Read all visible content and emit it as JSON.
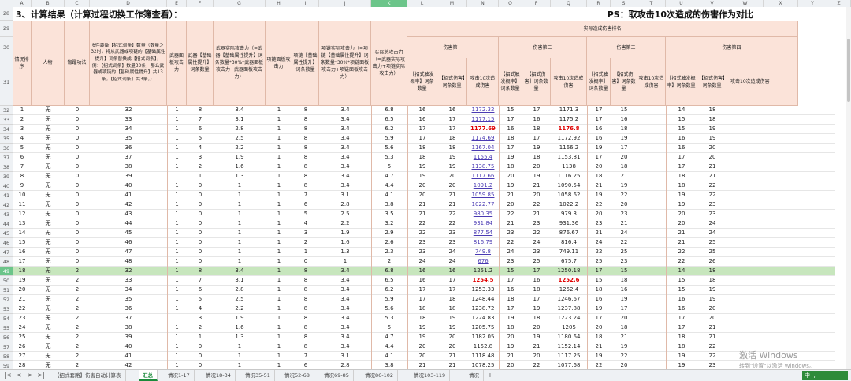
{
  "columns": [
    "A",
    "B",
    "C",
    "D",
    "E",
    "F",
    "G",
    "H",
    "I",
    "J",
    "K",
    "L",
    "M",
    "N",
    "O",
    "P",
    "Q",
    "R",
    "S",
    "T",
    "U",
    "V",
    "W",
    "X",
    "Y",
    "Z"
  ],
  "selected_column": "K",
  "title": {
    "left": "3、计算结果（计算过程切换工作簿查看）：",
    "right": "PS：取攻击10次造成的伤害作为对比"
  },
  "row_numbers": {
    "r28": "28",
    "r29": "29",
    "r30": "30",
    "r31": "31"
  },
  "headers": {
    "a": "情况排序",
    "b": "人物",
    "c": "锻躍功法",
    "d": "6件装备【招式词条】数量（数量＞32时，将从武器或项链的【基础属性提升】词条替换成【招式词条】，例：【招式词条】数量33条，那么武器或项链的【基础属性提升】共13条，【招式词条】共3条，）",
    "e": "武器面板攻击力",
    "f": "武器【基础属性提升】词条数量",
    "g": "武器实际攻击力（=武器【基础属性提升】词条数量*30%*武器面板攻击力+武器面板攻击力）",
    "h": "项链面板攻击力",
    "i": "项链【基础属性提升】词条数量",
    "j": "项链实际攻击力（=项链【基础属性提升】词条数量*30%*项链面板攻击力+项链面板攻击力）",
    "k": "实际总攻击力（=武器实际攻击力+项链实际攻击力）",
    "group": "实际造成伤害排名",
    "g1": "伤害第一",
    "g2": "伤害第二",
    "g3": "伤害第三",
    "g4": "伤害第四",
    "trig": "【招式触发概率】词条数量",
    "dmg": "【招式伤害】词条数量",
    "total": "攻击10次造成伤害"
  },
  "rows": [
    {
      "r": "32",
      "a": "1",
      "b": "无",
      "c": "0",
      "d": "32",
      "e": "1",
      "f": "8",
      "g": "3.4",
      "h": "1",
      "i": "8",
      "j": "3.4",
      "k": "6.8",
      "l": "16",
      "m": "16",
      "n": "1172.32",
      "o": "15",
      "p": "17",
      "q": "1171.3",
      "r2": "17",
      "s": "15",
      "u": "14",
      "v": "18",
      "nc": "lnk",
      "qc": ""
    },
    {
      "r": "33",
      "a": "2",
      "b": "无",
      "c": "0",
      "d": "33",
      "e": "1",
      "f": "7",
      "g": "3.1",
      "h": "1",
      "i": "8",
      "j": "3.4",
      "k": "6.5",
      "l": "16",
      "m": "17",
      "n": "1177.15",
      "o": "17",
      "p": "16",
      "q": "1175.2",
      "r2": "17",
      "s": "16",
      "u": "15",
      "v": "18",
      "nc": "lnk",
      "qc": ""
    },
    {
      "r": "34",
      "a": "3",
      "b": "无",
      "c": "0",
      "d": "34",
      "e": "1",
      "f": "6",
      "g": "2.8",
      "h": "1",
      "i": "8",
      "j": "3.4",
      "k": "6.2",
      "l": "17",
      "m": "17",
      "n": "1177.69",
      "o": "16",
      "p": "18",
      "q": "1176.8",
      "r2": "16",
      "s": "18",
      "u": "15",
      "v": "19",
      "nc": "red",
      "qc": "red"
    },
    {
      "r": "35",
      "a": "4",
      "b": "无",
      "c": "0",
      "d": "35",
      "e": "1",
      "f": "5",
      "g": "2.5",
      "h": "1",
      "i": "8",
      "j": "3.4",
      "k": "5.9",
      "l": "17",
      "m": "18",
      "n": "1174.69",
      "o": "18",
      "p": "17",
      "q": "1172.92",
      "r2": "16",
      "s": "19",
      "u": "16",
      "v": "19",
      "nc": "lnk",
      "qc": ""
    },
    {
      "r": "36",
      "a": "5",
      "b": "无",
      "c": "0",
      "d": "36",
      "e": "1",
      "f": "4",
      "g": "2.2",
      "h": "1",
      "i": "8",
      "j": "3.4",
      "k": "5.6",
      "l": "18",
      "m": "18",
      "n": "1167.04",
      "o": "17",
      "p": "19",
      "q": "1166.2",
      "r2": "19",
      "s": "17",
      "u": "16",
      "v": "20",
      "nc": "lnk",
      "qc": ""
    },
    {
      "r": "37",
      "a": "6",
      "b": "无",
      "c": "0",
      "d": "37",
      "e": "1",
      "f": "3",
      "g": "1.9",
      "h": "1",
      "i": "8",
      "j": "3.4",
      "k": "5.3",
      "l": "18",
      "m": "19",
      "n": "1155.4",
      "o": "19",
      "p": "18",
      "q": "1153.81",
      "r2": "17",
      "s": "20",
      "u": "17",
      "v": "20",
      "nc": "lnk",
      "qc": ""
    },
    {
      "r": "38",
      "a": "7",
      "b": "无",
      "c": "0",
      "d": "38",
      "e": "1",
      "f": "2",
      "g": "1.6",
      "h": "1",
      "i": "8",
      "j": "3.4",
      "k": "5",
      "l": "19",
      "m": "19",
      "n": "1138.75",
      "o": "18",
      "p": "20",
      "q": "1138",
      "r2": "20",
      "s": "18",
      "u": "17",
      "v": "21",
      "nc": "lnk",
      "qc": ""
    },
    {
      "r": "39",
      "a": "8",
      "b": "无",
      "c": "0",
      "d": "39",
      "e": "1",
      "f": "1",
      "g": "1.3",
      "h": "1",
      "i": "8",
      "j": "3.4",
      "k": "4.7",
      "l": "19",
      "m": "20",
      "n": "1117.66",
      "o": "20",
      "p": "19",
      "q": "1116.25",
      "r2": "18",
      "s": "21",
      "u": "18",
      "v": "21",
      "nc": "lnk",
      "qc": ""
    },
    {
      "r": "40",
      "a": "9",
      "b": "无",
      "c": "0",
      "d": "40",
      "e": "1",
      "f": "0",
      "g": "1",
      "h": "1",
      "i": "8",
      "j": "3.4",
      "k": "4.4",
      "l": "20",
      "m": "20",
      "n": "1091.2",
      "o": "19",
      "p": "21",
      "q": "1090.54",
      "r2": "21",
      "s": "19",
      "u": "18",
      "v": "22",
      "nc": "lnk",
      "qc": ""
    },
    {
      "r": "41",
      "a": "10",
      "b": "无",
      "c": "0",
      "d": "41",
      "e": "1",
      "f": "0",
      "g": "1",
      "h": "1",
      "i": "7",
      "j": "3.1",
      "k": "4.1",
      "l": "20",
      "m": "21",
      "n": "1059.85",
      "o": "21",
      "p": "20",
      "q": "1058.62",
      "r2": "19",
      "s": "22",
      "u": "19",
      "v": "22",
      "nc": "lnk",
      "qc": ""
    },
    {
      "r": "42",
      "a": "11",
      "b": "无",
      "c": "0",
      "d": "42",
      "e": "1",
      "f": "0",
      "g": "1",
      "h": "1",
      "i": "6",
      "j": "2.8",
      "k": "3.8",
      "l": "21",
      "m": "21",
      "n": "1022.77",
      "o": "20",
      "p": "22",
      "q": "1022.2",
      "r2": "22",
      "s": "20",
      "u": "19",
      "v": "23",
      "nc": "lnk",
      "qc": ""
    },
    {
      "r": "43",
      "a": "12",
      "b": "无",
      "c": "0",
      "d": "43",
      "e": "1",
      "f": "0",
      "g": "1",
      "h": "1",
      "i": "5",
      "j": "2.5",
      "k": "3.5",
      "l": "21",
      "m": "22",
      "n": "980.35",
      "o": "22",
      "p": "21",
      "q": "979.3",
      "r2": "20",
      "s": "23",
      "u": "20",
      "v": "23",
      "nc": "lnk",
      "qc": ""
    },
    {
      "r": "44",
      "a": "13",
      "b": "无",
      "c": "0",
      "d": "44",
      "e": "1",
      "f": "0",
      "g": "1",
      "h": "1",
      "i": "4",
      "j": "2.2",
      "k": "3.2",
      "l": "22",
      "m": "22",
      "n": "931.84",
      "o": "21",
      "p": "23",
      "q": "931.36",
      "r2": "23",
      "s": "21",
      "u": "20",
      "v": "24",
      "nc": "lnk",
      "qc": ""
    },
    {
      "r": "45",
      "a": "14",
      "b": "无",
      "c": "0",
      "d": "45",
      "e": "1",
      "f": "0",
      "g": "1",
      "h": "1",
      "i": "3",
      "j": "1.9",
      "k": "2.9",
      "l": "22",
      "m": "23",
      "n": "877.54",
      "o": "23",
      "p": "22",
      "q": "876.67",
      "r2": "21",
      "s": "24",
      "u": "21",
      "v": "24",
      "nc": "lnk",
      "qc": ""
    },
    {
      "r": "46",
      "a": "15",
      "b": "无",
      "c": "0",
      "d": "46",
      "e": "1",
      "f": "0",
      "g": "1",
      "h": "1",
      "i": "2",
      "j": "1.6",
      "k": "2.6",
      "l": "23",
      "m": "23",
      "n": "816.79",
      "o": "22",
      "p": "24",
      "q": "816.4",
      "r2": "24",
      "s": "22",
      "u": "21",
      "v": "25",
      "nc": "lnk",
      "qc": ""
    },
    {
      "r": "47",
      "a": "16",
      "b": "无",
      "c": "0",
      "d": "47",
      "e": "1",
      "f": "0",
      "g": "1",
      "h": "1",
      "i": "1",
      "j": "1.3",
      "k": "2.3",
      "l": "23",
      "m": "24",
      "n": "749.8",
      "o": "24",
      "p": "23",
      "q": "749.11",
      "r2": "22",
      "s": "25",
      "u": "22",
      "v": "25",
      "nc": "lnk",
      "qc": ""
    },
    {
      "r": "48",
      "a": "17",
      "b": "无",
      "c": "0",
      "d": "48",
      "e": "1",
      "f": "0",
      "g": "1",
      "h": "1",
      "i": "0",
      "j": "1",
      "k": "2",
      "l": "24",
      "m": "24",
      "n": "676",
      "o": "23",
      "p": "25",
      "q": "675.7",
      "r2": "25",
      "s": "23",
      "u": "22",
      "v": "26",
      "nc": "lnk",
      "qc": ""
    },
    {
      "r": "49",
      "a": "18",
      "b": "无",
      "c": "2",
      "d": "32",
      "e": "1",
      "f": "8",
      "g": "3.4",
      "h": "1",
      "i": "8",
      "j": "3.4",
      "k": "6.8",
      "l": "16",
      "m": "16",
      "n": "1251.2",
      "o": "15",
      "p": "17",
      "q": "1250.18",
      "r2": "17",
      "s": "15",
      "u": "14",
      "v": "18",
      "nc": "",
      "qc": "",
      "hl": true
    },
    {
      "r": "50",
      "a": "19",
      "b": "无",
      "c": "2",
      "d": "33",
      "e": "1",
      "f": "7",
      "g": "3.1",
      "h": "1",
      "i": "8",
      "j": "3.4",
      "k": "6.5",
      "l": "16",
      "m": "17",
      "n": "1254.5",
      "o": "17",
      "p": "16",
      "q": "1252.6",
      "r2": "15",
      "s": "18",
      "u": "15",
      "v": "18",
      "nc": "red",
      "qc": "red"
    },
    {
      "r": "51",
      "a": "20",
      "b": "无",
      "c": "2",
      "d": "34",
      "e": "1",
      "f": "6",
      "g": "2.8",
      "h": "1",
      "i": "8",
      "j": "3.4",
      "k": "6.2",
      "l": "17",
      "m": "17",
      "n": "1253.33",
      "o": "16",
      "p": "18",
      "q": "1252.4",
      "r2": "18",
      "s": "16",
      "u": "15",
      "v": "19",
      "nc": "",
      "qc": ""
    },
    {
      "r": "52",
      "a": "21",
      "b": "无",
      "c": "2",
      "d": "35",
      "e": "1",
      "f": "5",
      "g": "2.5",
      "h": "1",
      "i": "8",
      "j": "3.4",
      "k": "5.9",
      "l": "17",
      "m": "18",
      "n": "1248.44",
      "o": "18",
      "p": "17",
      "q": "1246.67",
      "r2": "16",
      "s": "19",
      "u": "16",
      "v": "19",
      "nc": "",
      "qc": ""
    },
    {
      "r": "53",
      "a": "22",
      "b": "无",
      "c": "2",
      "d": "36",
      "e": "1",
      "f": "4",
      "g": "2.2",
      "h": "1",
      "i": "8",
      "j": "3.4",
      "k": "5.6",
      "l": "18",
      "m": "18",
      "n": "1238.72",
      "o": "17",
      "p": "19",
      "q": "1237.88",
      "r2": "19",
      "s": "17",
      "u": "16",
      "v": "20",
      "nc": "",
      "qc": ""
    },
    {
      "r": "54",
      "a": "23",
      "b": "无",
      "c": "2",
      "d": "37",
      "e": "1",
      "f": "3",
      "g": "1.9",
      "h": "1",
      "i": "8",
      "j": "3.4",
      "k": "5.3",
      "l": "18",
      "m": "19",
      "n": "1224.83",
      "o": "19",
      "p": "18",
      "q": "1223.24",
      "r2": "17",
      "s": "20",
      "u": "17",
      "v": "20",
      "nc": "",
      "qc": ""
    },
    {
      "r": "55",
      "a": "24",
      "b": "无",
      "c": "2",
      "d": "38",
      "e": "1",
      "f": "2",
      "g": "1.6",
      "h": "1",
      "i": "8",
      "j": "3.4",
      "k": "5",
      "l": "19",
      "m": "19",
      "n": "1205.75",
      "o": "18",
      "p": "20",
      "q": "1205",
      "r2": "20",
      "s": "18",
      "u": "17",
      "v": "21",
      "nc": "",
      "qc": ""
    },
    {
      "r": "56",
      "a": "25",
      "b": "无",
      "c": "2",
      "d": "39",
      "e": "1",
      "f": "1",
      "g": "1.3",
      "h": "1",
      "i": "8",
      "j": "3.4",
      "k": "4.7",
      "l": "19",
      "m": "20",
      "n": "1182.05",
      "o": "20",
      "p": "19",
      "q": "1180.64",
      "r2": "18",
      "s": "21",
      "u": "18",
      "v": "21",
      "nc": "",
      "qc": ""
    },
    {
      "r": "57",
      "a": "26",
      "b": "无",
      "c": "2",
      "d": "40",
      "e": "1",
      "f": "0",
      "g": "1",
      "h": "1",
      "i": "8",
      "j": "3.4",
      "k": "4.4",
      "l": "20",
      "m": "20",
      "n": "1152.8",
      "o": "19",
      "p": "21",
      "q": "1152.14",
      "r2": "21",
      "s": "19",
      "u": "18",
      "v": "22",
      "nc": "",
      "qc": ""
    },
    {
      "r": "58",
      "a": "27",
      "b": "无",
      "c": "2",
      "d": "41",
      "e": "1",
      "f": "0",
      "g": "1",
      "h": "1",
      "i": "7",
      "j": "3.1",
      "k": "4.1",
      "l": "20",
      "m": "21",
      "n": "1118.48",
      "o": "21",
      "p": "20",
      "q": "1117.25",
      "r2": "19",
      "s": "22",
      "u": "19",
      "v": "22",
      "nc": "",
      "qc": ""
    },
    {
      "r": "59",
      "a": "28",
      "b": "无",
      "c": "2",
      "d": "42",
      "e": "1",
      "f": "0",
      "g": "1",
      "h": "1",
      "i": "6",
      "j": "2.8",
      "k": "3.8",
      "l": "21",
      "m": "21",
      "n": "1078.25",
      "o": "20",
      "p": "22",
      "q": "1077.68",
      "r2": "22",
      "s": "20",
      "u": "19",
      "v": "23",
      "nc": "",
      "qc": ""
    }
  ],
  "tabs": [
    "【招式套路】伤害自动计算表",
    "汇总",
    "情况1-17",
    "情况18-34",
    "情况35-51",
    "情况52-68",
    "情况69-85",
    "情况86-102",
    "情况103-119",
    "情况"
  ],
  "active_tab": "汇总",
  "nav": {
    "first": "|<",
    "prev": "<",
    "next": ">",
    "last": ">|",
    "add": "+"
  },
  "watermark": {
    "line1": "激活 Windows",
    "line2": "转到\"设置\"以激活 Windows。"
  },
  "ime": "中 ·,"
}
